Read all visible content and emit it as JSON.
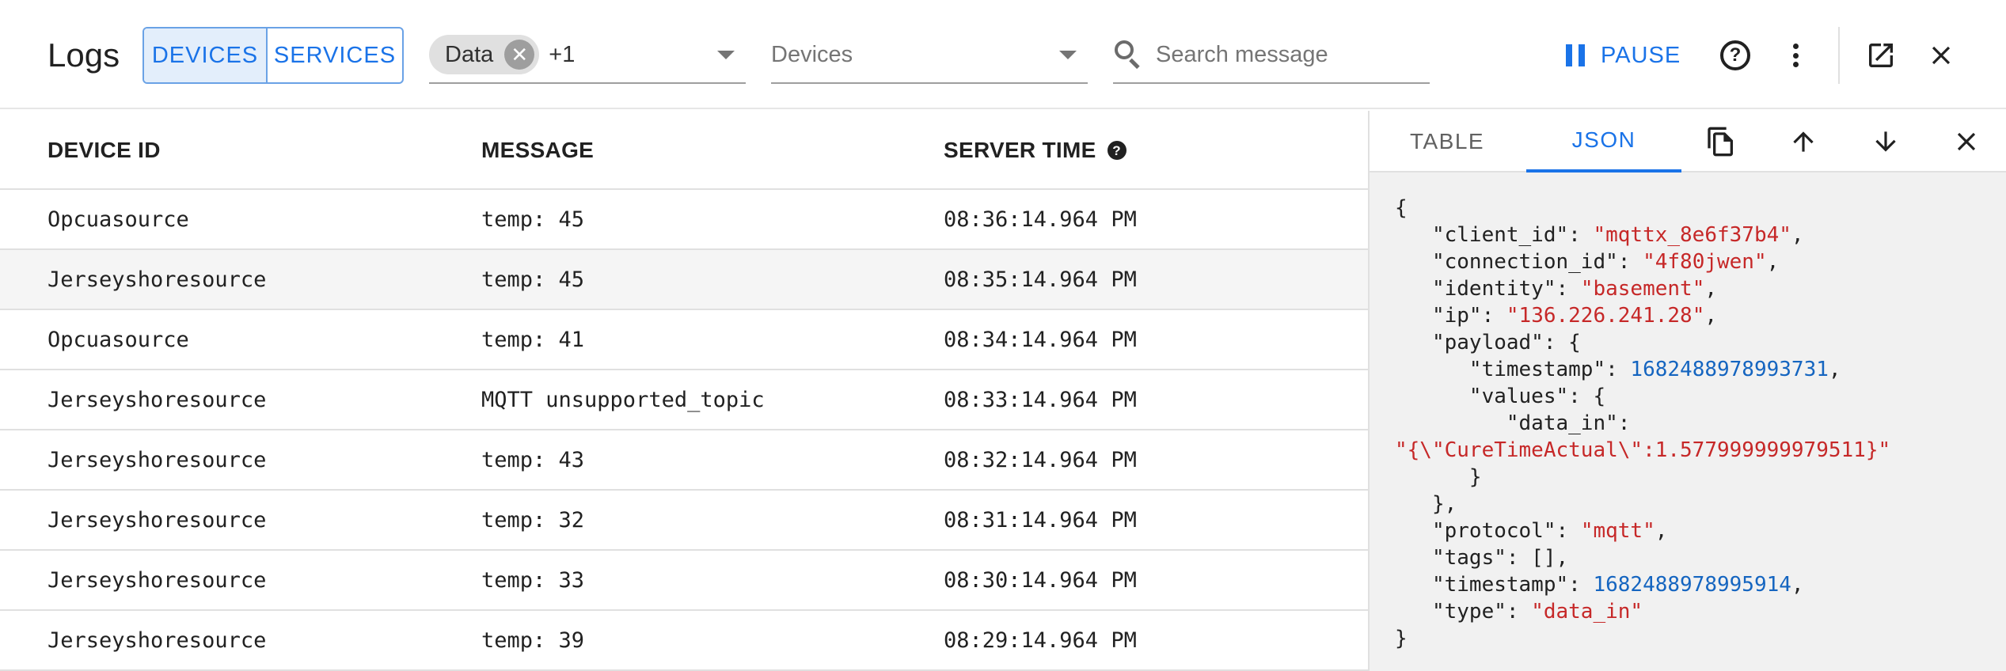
{
  "header": {
    "title": "Logs",
    "toggle": {
      "devices": "DEVICES",
      "services": "SERVICES"
    },
    "filter_chip": "Data",
    "filter_more": "+1",
    "devices_placeholder": "Devices",
    "search_placeholder": "Search message",
    "pause_label": "PAUSE"
  },
  "table": {
    "columns": {
      "device_id": "DEVICE ID",
      "message": "MESSAGE",
      "server_time": "SERVER TIME"
    },
    "rows": [
      {
        "device": "Opcuasource",
        "message": "temp: 45",
        "time": "08:36:14.964 PM"
      },
      {
        "device": "Jerseyshoresource",
        "message": "temp: 45",
        "time": "08:35:14.964 PM"
      },
      {
        "device": "Opcuasource",
        "message": "temp: 41",
        "time": "08:34:14.964 PM"
      },
      {
        "device": "Jerseyshoresource",
        "message": "MQTT unsupported_topic",
        "time": "08:33:14.964 PM"
      },
      {
        "device": "Jerseyshoresource",
        "message": "temp: 43",
        "time": "08:32:14.964 PM"
      },
      {
        "device": "Jerseyshoresource",
        "message": "temp: 32",
        "time": "08:31:14.964 PM"
      },
      {
        "device": "Jerseyshoresource",
        "message": "temp: 33",
        "time": "08:30:14.964 PM"
      },
      {
        "device": "Jerseyshoresource",
        "message": "temp: 39",
        "time": "08:29:14.964 PM"
      }
    ]
  },
  "panel": {
    "tabs": {
      "table": "TABLE",
      "json": "JSON"
    },
    "json": {
      "client_id": "\"mqttx_8e6f37b4\"",
      "connection_id": "\"4f80jwen\"",
      "identity": "\"basement\"",
      "ip": "\"136.226.241.28\"",
      "payload_timestamp": "1682488978993731",
      "data_in": "\"{\\\"CureTimeActual\\\":1.577999999979511}\"",
      "protocol": "\"mqtt\"",
      "timestamp": "1682488978995914",
      "type": "\"data_in\""
    }
  },
  "icons": {
    "search": "search-icon",
    "pause": "pause-icon",
    "help": "help-icon",
    "more": "more-vert-icon",
    "open": "open-in-new-icon",
    "close": "close-icon",
    "copy": "copy-icon",
    "up": "arrow-up-icon",
    "down": "arrow-down-icon",
    "clear": "clear-chip-icon",
    "dropdown": "dropdown-caret-icon"
  },
  "colors": {
    "accent": "#1a73e8",
    "json_string": "#c62828",
    "json_number": "#1565c0",
    "panel_bg": "#f1f1f1",
    "row_highlight": "#f5f5f5"
  }
}
